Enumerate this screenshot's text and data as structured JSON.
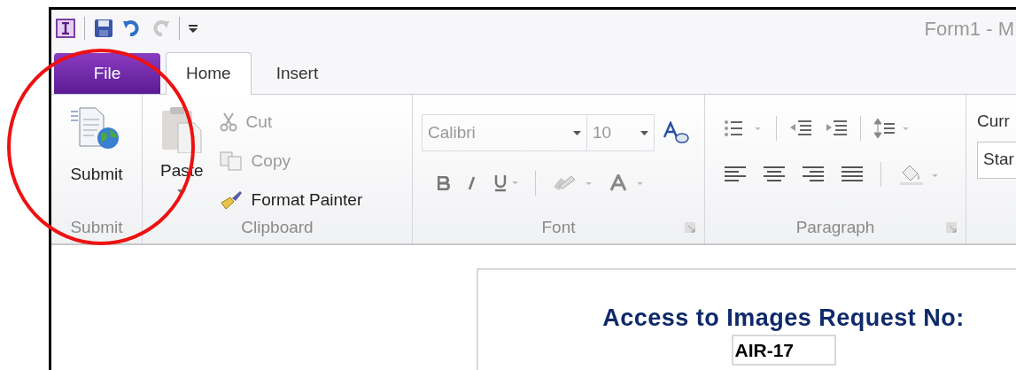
{
  "window": {
    "title": "Form1 - M"
  },
  "tabs": [
    {
      "label": "File",
      "kind": "backstage",
      "selected": false
    },
    {
      "label": "Home",
      "kind": "tab",
      "selected": true
    },
    {
      "label": "Insert",
      "kind": "tab",
      "selected": false
    }
  ],
  "ribbon": {
    "submit_group": {
      "button": "Submit",
      "label": "Submit"
    },
    "clipboard_group": {
      "paste": "Paste",
      "items": [
        {
          "label": "Cut",
          "kind": "cut",
          "disabled": true
        },
        {
          "label": "Copy",
          "kind": "copy",
          "disabled": true
        },
        {
          "label": "Format Painter",
          "kind": "painter",
          "disabled": false
        }
      ],
      "label": "Clipboard"
    },
    "font_group": {
      "font_name": "Calibri",
      "font_size": "10",
      "label": "Font"
    },
    "paragraph_group": {
      "label": "Paragraph"
    },
    "current_group": {
      "label": "Curr",
      "value": "Star"
    }
  },
  "form": {
    "heading": "Access to Images Request No:",
    "request_no": "AIR-17"
  }
}
